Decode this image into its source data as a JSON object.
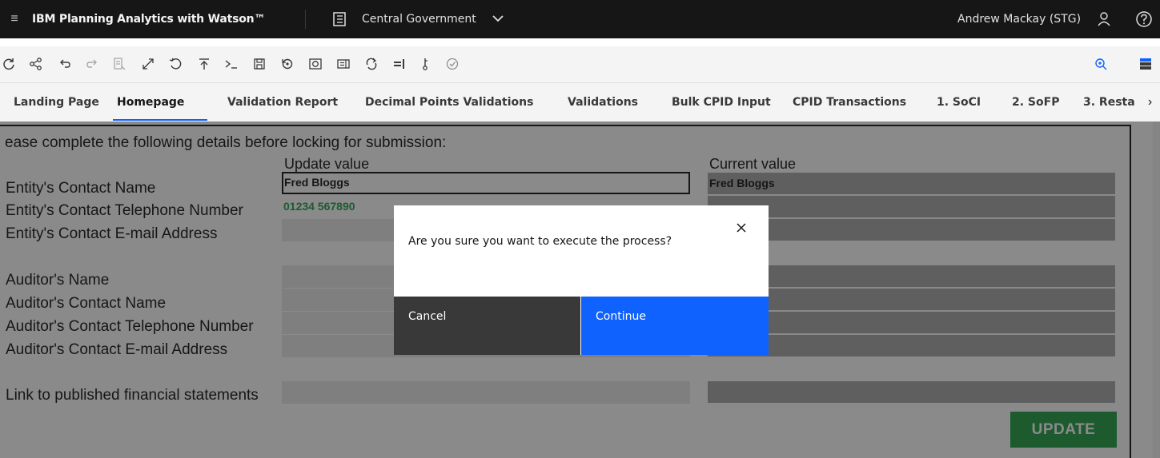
{
  "header": {
    "app_title": "IBM Planning Analytics with Watson™",
    "context_label": "Central Government",
    "user_name": "Andrew Mackay (STG)"
  },
  "toolbar": {
    "buttons": [
      "refresh-icon",
      "share-icon",
      "undo-icon",
      "redo-icon",
      "sandbox-icon",
      "expand-icon",
      "reset-icon",
      "publish-icon",
      "terminal-icon",
      "save-icon",
      "spread-icon",
      "snapshot-icon",
      "commentary-icon",
      "sync-icon",
      "align-icon",
      "thermometer-icon",
      "check-icon",
      "zoom-in-icon",
      "properties-icon"
    ]
  },
  "tabs": [
    {
      "label": "Landing Page"
    },
    {
      "label": "Homepage"
    },
    {
      "label": "Validation Report"
    },
    {
      "label": "Decimal Points Validations"
    },
    {
      "label": "Validations"
    },
    {
      "label": "Bulk CPID Input"
    },
    {
      "label": "CPID Transactions"
    },
    {
      "label": "1. SoCI"
    },
    {
      "label": "2. SoFP"
    },
    {
      "label": "3. Resta"
    }
  ],
  "sheet": {
    "intro": "ease complete the following details before locking for submission:",
    "col_update": "Update value",
    "col_current": "Current value",
    "rows": [
      {
        "label": "Entity's Contact Name",
        "update": "Fred Bloggs",
        "current": "Fred Bloggs"
      },
      {
        "label": "Entity's Contact Telephone Number",
        "update": "01234 567890",
        "current": ""
      },
      {
        "label": "Entity's Contact E-mail Address",
        "update": "",
        "current": ""
      },
      {
        "label": "Auditor's Name",
        "update": "",
        "current": ""
      },
      {
        "label": "Auditor's Contact Name",
        "update": "",
        "current": ""
      },
      {
        "label": "Auditor's Contact Telephone Number",
        "update": "",
        "current": ""
      },
      {
        "label": "Auditor's Contact E-mail Address",
        "update": "",
        "current": ""
      },
      {
        "label": "Link to published financial statements",
        "update": "",
        "current": ""
      }
    ],
    "update_button": "UPDATE"
  },
  "dialog": {
    "message": "Are you sure you want to execute the process?",
    "cancel_label": "Cancel",
    "continue_label": "Continue"
  },
  "colors": {
    "primary": "#0f62fe",
    "update_green": "#24a148",
    "header_bg": "#161616",
    "cancel_bg": "#393939"
  }
}
